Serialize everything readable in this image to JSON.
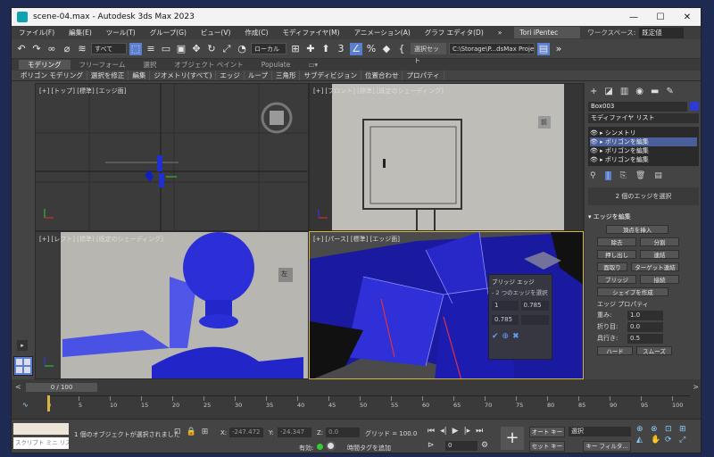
{
  "window": {
    "title": "scene-04.max - Autodesk 3ds Max 2023"
  },
  "menu": [
    "ファイル(F)",
    "編集(E)",
    "ツール(T)",
    "グループ(G)",
    "ビュー(V)",
    "作成(C)",
    "モディファイヤ(M)",
    "アニメーション(A)",
    "グラフ エディタ(D)"
  ],
  "user": "Tori iPentec",
  "workspace_label": "ワークスペース:",
  "workspace_value": "既定値",
  "toolbar": {
    "filter": "すべて",
    "coord": "ローカル",
    "selection_set": "選択セット",
    "path": "C:\\Storage\\P...dsMax Project"
  },
  "ribbon_tabs": [
    "モデリング",
    "フリーフォーム",
    "選択",
    "オブジェクト ペイント",
    "Populate"
  ],
  "ribbon_items": [
    "ポリゴン モデリング",
    "選択を修正",
    "編集",
    "ジオメトリ(すべて)",
    "エッジ",
    "ループ",
    "三角形",
    "サブディビジョン",
    "位置合わせ",
    "プロパティ"
  ],
  "viewports": {
    "top": "[+] [トップ] [標準] [エッジ面]",
    "front": "[+] [フロント] [標準] [既定のシェーディング]",
    "left": "[+] [レフト] [標準] [既定のシェーディング]",
    "persp": "[+] [パース] [標準] [エッジ面]",
    "front_cube": "前",
    "left_cube": "左"
  },
  "caddy": {
    "title": "ブリッジ エッジ",
    "subtitle": "- 2 つのエッジを選択",
    "segments": "1",
    "smooth": "0.785",
    "angle": "0.785"
  },
  "command_panel": {
    "object_name": "Box003",
    "modifier_list": "モディファイヤ リスト",
    "stack": [
      "シンメトリ",
      "ポリゴンを編集",
      "ポリゴンを編集",
      "ポリゴンを編集"
    ],
    "selection_info": "2 個のエッジを選択",
    "rollout_title": "エッジを編集",
    "insert_vertex": "頂点を挿入",
    "remove": "除去",
    "split": "分割",
    "extrude": "押し出し",
    "weld": "連結",
    "chamfer": "面取り",
    "target_weld": "ターゲット連結",
    "bridge": "ブリッジ",
    "connect": "接続",
    "create_shape": "シェイプを作成",
    "edge_props": "エッジ プロパティ",
    "weight_label": "重み:",
    "weight": "1.0",
    "crease_label": "折り目:",
    "crease": "0.0",
    "depth_label": "具行き:",
    "depth": "0.5",
    "hard": "ハード",
    "smooth_btn": "スムーズ"
  },
  "timeline": {
    "frame": "0 / 100",
    "ticks": [
      "0",
      "5",
      "10",
      "15",
      "20",
      "25",
      "30",
      "35",
      "40",
      "45",
      "50",
      "55",
      "60",
      "65",
      "70",
      "75",
      "80",
      "85",
      "90",
      "95",
      "100"
    ]
  },
  "status": {
    "script_placeholder": "スクリプト ミニ リス",
    "message": "1 個のオブジェクトが選択されました",
    "x_label": "X:",
    "x": "-247.472",
    "y_label": "Y:",
    "y": "-24.347",
    "z_label": "Z:",
    "z": "0.0",
    "grid": "グリッド = 100.0",
    "enable": "有効:",
    "add_time_tag": "時間タグを追加",
    "frame_field": "0",
    "auto_key": "オート キー",
    "selection": "選択",
    "set_key": "セット キー",
    "key_filter": "キー フィルタ..."
  }
}
